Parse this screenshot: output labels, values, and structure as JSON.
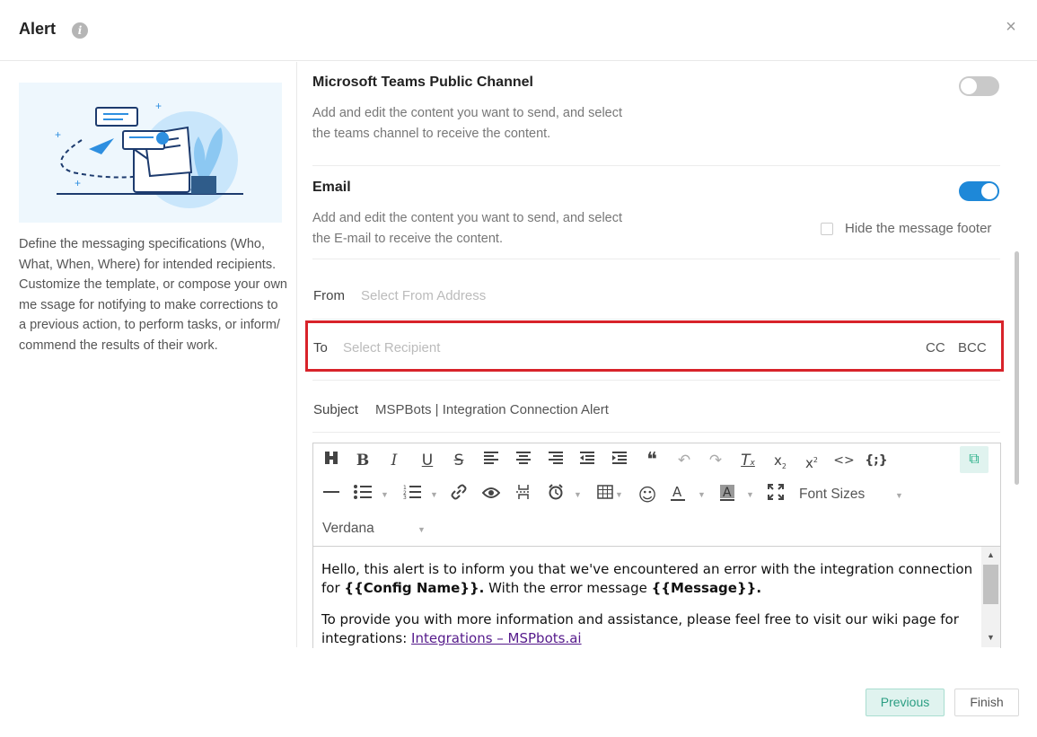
{
  "dialog": {
    "title": "Alert",
    "close_symbol": "×"
  },
  "left": {
    "description": "Define the messaging specifications (Who, What, When, Where) for intended recipients. Customize the template, or compose your own me ssage for notifying to make corrections to a previous action, to perform tasks, or inform/ commend the results of their work."
  },
  "teams": {
    "title": "Microsoft Teams Public Channel",
    "desc_line1": "Add and edit the content you want to send, and select",
    "desc_line2": "the teams channel to receive the content.",
    "enabled": false
  },
  "email": {
    "title": "Email",
    "desc_line1": "Add and edit the content you want to send, and select",
    "desc_line2": "the E-mail to receive the content.",
    "enabled": true,
    "hide_footer_label": "Hide the message footer",
    "from_label": "From",
    "from_placeholder": "Select From Address",
    "to_label": "To",
    "to_placeholder": "Select Recipient",
    "cc_label": "CC",
    "bcc_label": "BCC",
    "subject_label": "Subject",
    "subject_value": "MSPBots | Integration Connection Alert"
  },
  "editor": {
    "font_size_label": "Font Sizes",
    "font_family_label": "Verdana",
    "body_p1_a": "Hello, this alert is to inform you that we've encountered an error with the integration connection for ",
    "body_p1_var1": "{{Config Name}}.",
    "body_p1_b": " With the error message ",
    "body_p1_var2": "{{Message}}.",
    "body_p2_a": "To provide you with more information and assistance, please feel free to visit our wiki page for integrations: ",
    "body_p2_link": "Integrations – MSPbots.ai"
  },
  "icons": {
    "quote": "❝",
    "emoji": "☺"
  },
  "footer": {
    "previous_label": "Previous",
    "finish_label": "Finish"
  },
  "colors": {
    "accent_blue": "#1e88d8",
    "highlight_red": "#d8232a",
    "teal": "#2b9e83"
  }
}
